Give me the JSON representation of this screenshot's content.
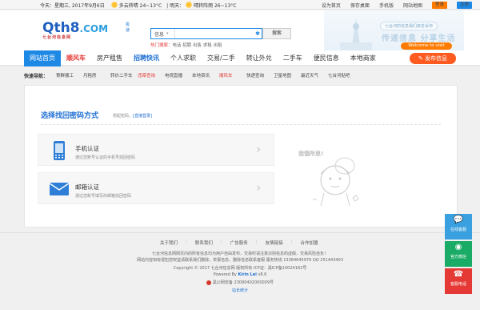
{
  "topbar": {
    "date": "今天：星期三, 2017年9月6日",
    "weather_today_icon": "sun-cloud-icon",
    "weather_today": "多云转晴 24~13°C",
    "tomorrow_label": "| 明天：",
    "weather_tomorrow_icon": "sun-icon",
    "weather_tomorrow": "晴转阵雨 26~13°C",
    "links": [
      "设为首页",
      "保存桌面",
      "手机版",
      "网站地图"
    ],
    "login": "登录",
    "register": "注册"
  },
  "header": {
    "logo_text": "Qth8",
    "logo_com": ".COM",
    "logo_sub": "七台河信息网",
    "logo_tag": "极速",
    "search_select": "信息",
    "search_placeholder": "",
    "search_button": "搜索",
    "hot_label": "热门搜索：",
    "hot_terms": "电话 招聘 出售 求租 出租",
    "banner_bubble": "七台河的信息我们来告诉你",
    "banner_slogan": "传递信息 分享生活",
    "banner_welcome": "Welcome to visit"
  },
  "nav": {
    "items": [
      "网站首页",
      "顺风车",
      "房产租售",
      "招聘快讯",
      "个人求职",
      "交易/二手",
      "转让外兑",
      "二手车",
      "便民信息",
      "本地商家"
    ],
    "post_button": "✎ 发布信息"
  },
  "quicknav": {
    "label": "快速导航：",
    "items": [
      "寄群顺工",
      "月租房",
      "转价二手车",
      "违章查询",
      "电视直播",
      "本地资讯",
      "顺风车",
      "快递查询",
      "卫星地图",
      "最近天气",
      "七台河贴吧"
    ]
  },
  "main": {
    "title": "选择找回密码方式",
    "crumb_text": "想起密码，",
    "crumb_link": "[直接登录]",
    "options": [
      {
        "icon": "mobile-phone-icon",
        "name": "手机认证",
        "desc": "通过您账号认证的手机号找回密码"
      },
      {
        "icon": "email-envelope-icon",
        "name": "邮箱认证",
        "desc": "通过您账号填写的邮箱找回密码"
      }
    ],
    "illustration_caption": "我饿所思!",
    "colors": {
      "accent": "#1e88e5",
      "orange": "#ff7a00",
      "red": "#e53935"
    }
  },
  "footer": {
    "links": [
      "关于我们",
      "联系我们",
      "广告服务",
      "友情链接",
      "合作加盟"
    ],
    "line1": "七台河信息网网页内的所有信息均为用户自由发布，交易时请注意识别信息的虚假，交易风险自负！",
    "line2": "网站内容如有侵犯您权益请联系我们删除，举报信息、删除信息联系客服   服务热线 13384645979 QQ 251443403",
    "line3": "Copyright © 2017  七台河信息网  版权所有  ICP证：黑ICP备10024182号",
    "powered_prefix": "Powered By ",
    "powered_name": "Kirin Lei",
    "powered_ver": " v8.6",
    "police": "黑公网安备 23090402000009号",
    "stats": "站长统计"
  },
  "side": [
    {
      "icon": "chat-bubble-icon",
      "label": "在线客服"
    },
    {
      "icon": "wechat-icon",
      "label": "官方微信"
    },
    {
      "icon": "phone-icon",
      "label": "客服电话"
    }
  ]
}
